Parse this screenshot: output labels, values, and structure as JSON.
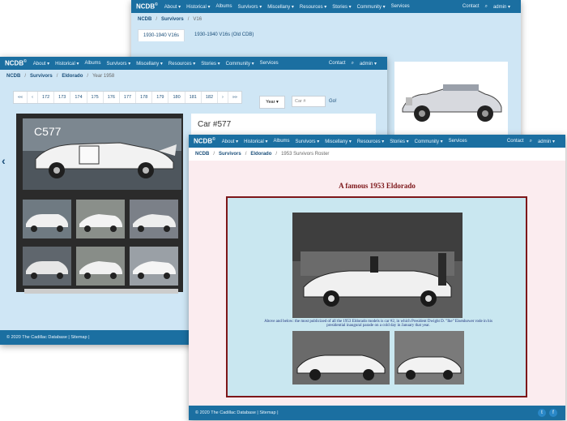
{
  "nav": {
    "brand": "NCDB",
    "brand_mark": "©",
    "items": [
      "About ▾",
      "Historical ▾",
      "Albums",
      "Survivors ▾",
      "Miscellany ▾",
      "Resources ▾",
      "Stories ▾",
      "Community ▾",
      "Services"
    ],
    "contact": "Contact",
    "user": "admin ▾"
  },
  "back_window": {
    "breadcrumb": [
      "NCDB",
      "Survivors",
      "V16"
    ],
    "tabs": [
      "1930-1940 V16s",
      "1930-1940 V16s (Old CDB)"
    ]
  },
  "middle_window": {
    "breadcrumb": [
      "NCDB",
      "Survivors",
      "Eldorado",
      "Year 1958"
    ],
    "pager": [
      "««",
      "‹",
      "172",
      "173",
      "174",
      "175",
      "176",
      "177",
      "178",
      "179",
      "180",
      "181",
      "182",
      "›",
      "»»"
    ],
    "year_select": "Year ▾",
    "car_placeholder": "Car #",
    "go_label": "Go!",
    "viewer_caption": "C577",
    "card_title": "Car #577",
    "footer": "© 2020 The Cadillac Database | Sitemap |"
  },
  "front_window": {
    "breadcrumb": [
      "NCDB",
      "Survivors",
      "Eldorado",
      "1953 Survivors Roster"
    ],
    "page_title": "A famous 1953 Eldorado",
    "photo_caption": "Above and below: the most publicized of all the 1953 Eldorado models is car #2, in which President Dwight D. \"Ike\" Eisenhower rode in his presidential inaugural parade on a cold day in January that year.",
    "footer": "© 2020 The Cadillac Database | Sitemap |",
    "social": [
      "t",
      "f"
    ]
  }
}
